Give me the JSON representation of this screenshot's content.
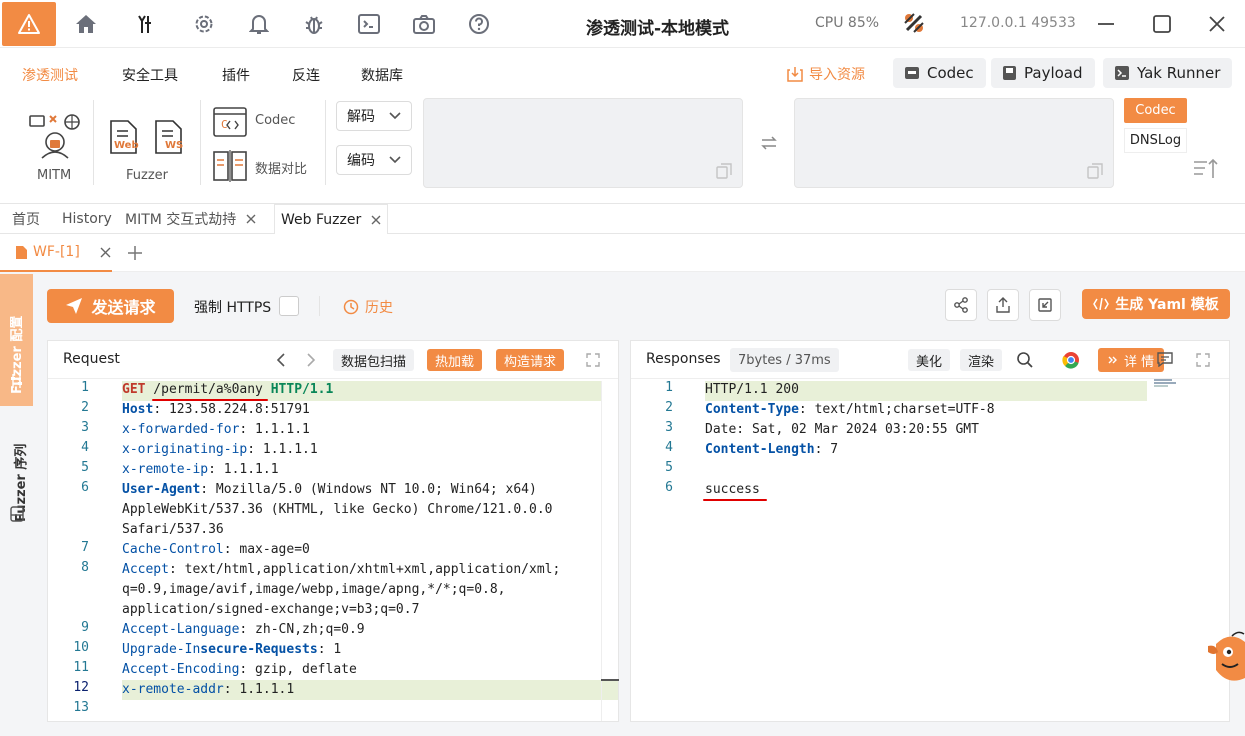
{
  "titlebar": {
    "app_title": "渗透测试-本地模式",
    "cpu": "CPU 85%",
    "address": "127.0.0.1 49533"
  },
  "menubar": {
    "items": [
      "渗透测试",
      "安全工具",
      "插件",
      "反连",
      "数据库"
    ],
    "import": "导入资源",
    "codec": "Codec",
    "payload": "Payload",
    "yak_runner": "Yak Runner"
  },
  "ribbon": {
    "mitm": "MITM",
    "fuzzer": "Fuzzer",
    "web_tag": "Web",
    "ws_tag": "WS",
    "codec": "Codec",
    "compare": "数据对比",
    "decode": "解码",
    "encode": "编码",
    "codec_tab": "Codec",
    "dnslog_tab": "DNSLog"
  },
  "tabs": [
    "首页",
    "History",
    "MITM 交互式劫持",
    "Web Fuzzer"
  ],
  "subtab": "WF-[1]",
  "side": {
    "config": "Fuzzer 配置",
    "sequence": "Fuzzer 序列"
  },
  "toolbar": {
    "send": "发送请求",
    "https": "强制 HTTPS",
    "history": "历史",
    "yaml": "生成 Yaml 模板"
  },
  "request": {
    "title": "Request",
    "scan": "数据包扫描",
    "hotload": "热加载",
    "build": "构造请求",
    "lines": [
      {
        "n": "1",
        "parts": [
          {
            "c": "red",
            "t": "GET"
          },
          {
            "c": "plain",
            "t": " /permit/a%0any "
          },
          {
            "c": "grn",
            "t": "HTTP/1.1"
          }
        ]
      },
      {
        "n": "2",
        "parts": [
          {
            "c": "kwb",
            "t": "Host"
          },
          {
            "c": "plain",
            "t": ": 123.58.224.8:51791"
          }
        ]
      },
      {
        "n": "3",
        "parts": [
          {
            "c": "kw",
            "t": "x-forwarded-for"
          },
          {
            "c": "plain",
            "t": ": 1.1.1.1"
          }
        ]
      },
      {
        "n": "4",
        "parts": [
          {
            "c": "kw",
            "t": "x-originating-ip"
          },
          {
            "c": "plain",
            "t": ": 1.1.1.1"
          }
        ]
      },
      {
        "n": "5",
        "parts": [
          {
            "c": "kw",
            "t": "x-remote-ip"
          },
          {
            "c": "plain",
            "t": ": 1.1.1.1"
          }
        ]
      },
      {
        "n": "6",
        "parts": [
          {
            "c": "kwb",
            "t": "User-Agent"
          },
          {
            "c": "plain",
            "t": ": Mozilla/5.0 (Windows NT 10.0; Win64; x64)"
          }
        ]
      },
      {
        "n": "",
        "parts": [
          {
            "c": "plain",
            "t": "AppleWebKit/537.36 (KHTML, like Gecko) Chrome/121.0.0.0"
          }
        ]
      },
      {
        "n": "",
        "parts": [
          {
            "c": "plain",
            "t": "Safari/537.36"
          }
        ]
      },
      {
        "n": "7",
        "parts": [
          {
            "c": "kw",
            "t": "Cache-Control"
          },
          {
            "c": "plain",
            "t": ": max-age=0"
          }
        ]
      },
      {
        "n": "8",
        "parts": [
          {
            "c": "kw",
            "t": "Accept"
          },
          {
            "c": "plain",
            "t": ": text/html,application/xhtml+xml,application/xml;"
          }
        ]
      },
      {
        "n": "",
        "parts": [
          {
            "c": "plain",
            "t": "q=0.9,image/avif,image/webp,image/apng,*/*;q=0.8,"
          }
        ]
      },
      {
        "n": "",
        "parts": [
          {
            "c": "plain",
            "t": "application/signed-exchange;v=b3;q=0.7"
          }
        ]
      },
      {
        "n": "9",
        "parts": [
          {
            "c": "kw",
            "t": "Accept-Language"
          },
          {
            "c": "plain",
            "t": ": zh-CN,zh;q=0.9"
          }
        ]
      },
      {
        "n": "10",
        "parts": [
          {
            "c": "kw",
            "t": "Upgrade-In"
          },
          {
            "c": "kwb",
            "t": "secure-Requests"
          },
          {
            "c": "plain",
            "t": ": 1"
          }
        ]
      },
      {
        "n": "11",
        "parts": [
          {
            "c": "kw",
            "t": "Accept-Encoding"
          },
          {
            "c": "plain",
            "t": ": gzip, deflate"
          }
        ]
      },
      {
        "n": "12",
        "parts": [
          {
            "c": "kw",
            "t": "x-remote-addr"
          },
          {
            "c": "plain",
            "t": ": 1.1.1.1"
          }
        ]
      },
      {
        "n": "13",
        "parts": []
      }
    ]
  },
  "response": {
    "title": "Responses",
    "meta": "7bytes / 37ms",
    "beautify": "美化",
    "render": "渲染",
    "detail": "详 情",
    "lines": [
      {
        "n": "1",
        "parts": [
          {
            "c": "plain",
            "t": "HTTP/1.1 200"
          }
        ]
      },
      {
        "n": "2",
        "parts": [
          {
            "c": "kwb",
            "t": "Content-Type"
          },
          {
            "c": "plain",
            "t": ": text/html;charset=UTF-8"
          }
        ]
      },
      {
        "n": "3",
        "parts": [
          {
            "c": "plain",
            "t": "Date: Sat, 02 Mar 2024 03:20:55 GMT"
          }
        ]
      },
      {
        "n": "4",
        "parts": [
          {
            "c": "kwb",
            "t": "Content-Length"
          },
          {
            "c": "plain",
            "t": ": 7"
          }
        ]
      },
      {
        "n": "5",
        "parts": []
      },
      {
        "n": "6",
        "parts": [
          {
            "c": "plain",
            "t": "success"
          }
        ]
      }
    ]
  },
  "colors": {
    "accent": "#f28b44",
    "underline": "#e00000"
  }
}
